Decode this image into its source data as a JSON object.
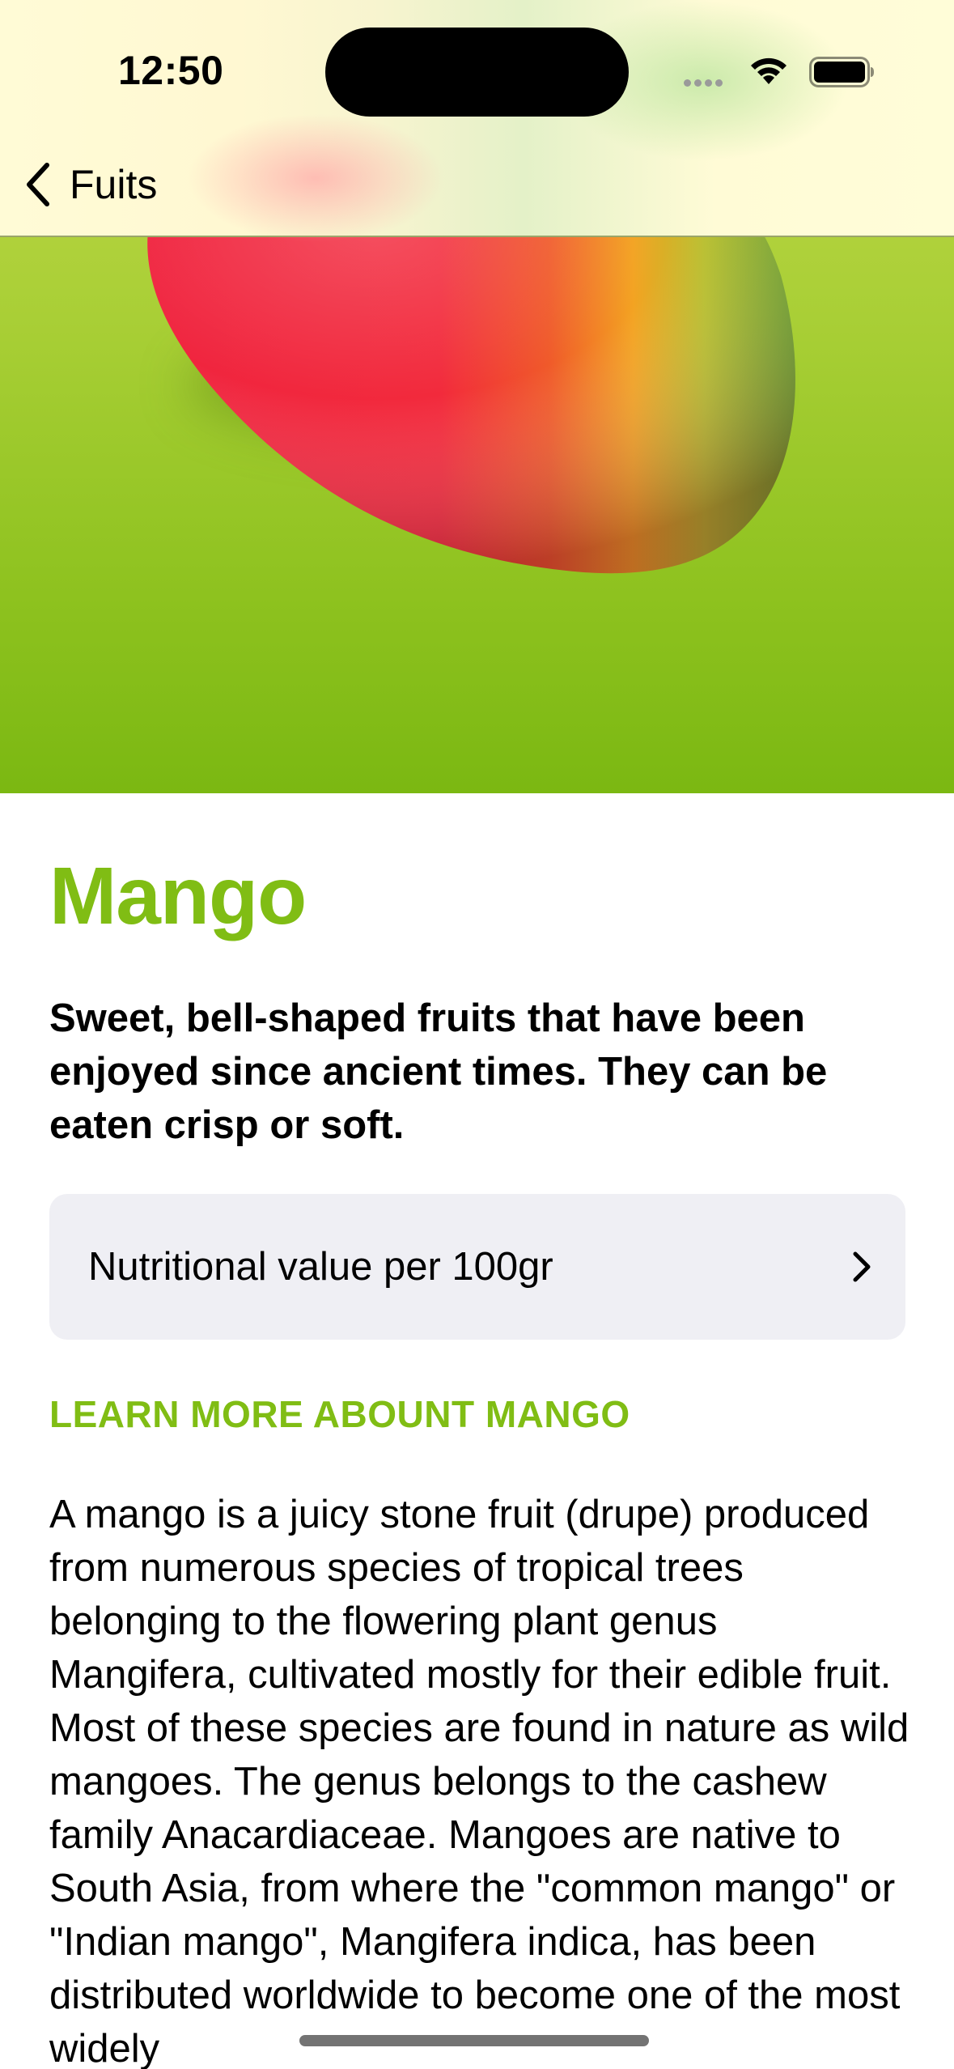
{
  "status_bar": {
    "time": "12:50"
  },
  "nav": {
    "back_label": "Fuits"
  },
  "fruit": {
    "name": "Mango",
    "headline": "Sweet, bell-shaped fruits that have been enjoyed since ancient times. They can be eaten crisp or soft.",
    "nutrition_label": "Nutritional value per 100gr",
    "learn_more_heading": "LEARN MORE ABOUNT MANGO",
    "description": "A mango is a juicy stone fruit (drupe) produced from numerous species of tropical trees belonging to the flowering plant genus Mangifera, cultivated mostly for their edible fruit. Most of these species are found in nature as wild mangoes. The genus belongs to the cashew family Anacardiaceae. Mangoes are native to South Asia, from where the \"common mango\" or \"Indian mango\", Mangifera indica, has been distributed worldwide to become one of the most widely"
  },
  "colors": {
    "accent_green": "#80bd14",
    "hero_top": "#c3d84a",
    "hero_bottom": "#7bb812",
    "card_background": "#efeff4"
  },
  "icons": {
    "back": "chevron-left-icon",
    "nutrition_disclosure": "chevron-right-icon",
    "wifi": "wifi-icon",
    "battery": "battery-icon",
    "hero_image": "mango-image"
  }
}
